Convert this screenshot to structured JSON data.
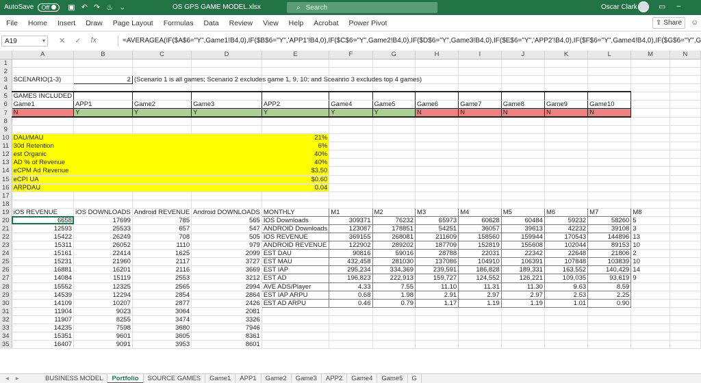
{
  "titlebar": {
    "autosave_label": "AutoSave",
    "autosave_state": "Off",
    "file_name": "OS GPS GAME MODEL.xlsx",
    "search_placeholder": "Search",
    "user_name": "Oscar Clark"
  },
  "ribbon": {
    "tabs": [
      "File",
      "Home",
      "Insert",
      "Draw",
      "Page Layout",
      "Formulas",
      "Data",
      "Review",
      "View",
      "Help",
      "Acrobat",
      "Power Pivot"
    ],
    "share_label": "Share"
  },
  "formula_bar": {
    "name_box": "A19",
    "formula": "=AVERAGEA(IF($A$6=\"Y\",Game1!B4,0),IF($B$6=\"Y\",'APP1'!B4,0),IF($C$6=\"Y\",Game2!B4,0),IF($D$6=\"Y\",Game3!B4,0),IF($E$6=\"Y\",'APP2'!B4,0),IF($F$6=\"Y\",Game4!B4,0),IF($G$6=\"Y\",Game5!B4,0),IF($H$6=\"Y\",Game6!B4,0)"
  },
  "columns": [
    "A",
    "B",
    "C",
    "D",
    "E",
    "F",
    "G",
    "H",
    "I",
    "J",
    "K",
    "L",
    "M",
    "N"
  ],
  "rows": [
    [],
    [],
    [
      "SCENARIO(1-3)",
      "2",
      "(Scenario 1 is all games; Scenario 2 excludes game 1, 9, 10; and Sceanrio 3 excludes top 4 games)"
    ],
    [],
    [
      "GAMES INCLUDED"
    ],
    [
      "Game1",
      "APP1",
      "Game2",
      "Game3",
      "APP2",
      "Game4",
      "Game5",
      "Game6",
      "Game7",
      "Game8",
      "Game9",
      "Game10"
    ],
    [
      "N",
      "Y",
      "Y",
      "Y",
      "Y",
      "Y",
      "Y",
      "N",
      "N",
      "N",
      "N",
      "N"
    ],
    [],
    [],
    [
      "DAU/MAU",
      "21%"
    ],
    [
      "30d Retention",
      "6%"
    ],
    [
      "est Organic",
      "40%"
    ],
    [
      "AD % of Revenue",
      "40%"
    ],
    [
      "eCPM Ad Revenue",
      "$3.50"
    ],
    [
      "eCPI UA",
      "$0.60"
    ],
    [
      "ARPDAU",
      "0.04"
    ],
    [],
    [],
    [
      "iOS REVENUE",
      "iOS DOWNLOADS",
      "Android REVENUE",
      "Android DOWNLOADS",
      "MONTHLY",
      "M1",
      "M2",
      "M3",
      "M4",
      "M5",
      "M6",
      "M7",
      "M8"
    ],
    [
      "6658",
      "17699",
      "785",
      "565",
      "IOS Downloads",
      "309371",
      "76232",
      "65973",
      "60628",
      "60484",
      "59232",
      "58260",
      "5"
    ],
    [
      "12593",
      "25533",
      "657",
      "547",
      "ANDROID Downloads",
      "123087",
      "178851",
      "54251",
      "36057",
      "39613",
      "42232",
      "39108",
      "3"
    ],
    [
      "15422",
      "26249",
      "708",
      "505",
      "IOS REVENUE",
      "369155",
      "268081",
      "211609",
      "158560",
      "159944",
      "170543",
      "144896",
      "13"
    ],
    [
      "15311",
      "26052",
      "1110",
      "979",
      "ANDROID REVENUE",
      "122902",
      "289202",
      "187709",
      "152819",
      "155608",
      "102044",
      "89153",
      "10"
    ],
    [
      "15161",
      "22414",
      "1625",
      "2099",
      "EST DAU",
      "90816",
      "59016",
      "28788",
      "22031",
      "22342",
      "22648",
      "21806",
      "2"
    ],
    [
      "15231",
      "21960",
      "2117",
      "3727",
      "EST MAU",
      "432,458",
      "281030",
      "137086",
      "104910",
      "106391",
      "107848",
      "103839",
      "10"
    ],
    [
      "16881",
      "16201",
      "2116",
      "3669",
      "EST IAP",
      "295,234",
      "334,369",
      "239,591",
      "186,828",
      "189,331",
      "163,552",
      "140,429",
      "14"
    ],
    [
      "14084",
      "15119",
      "2553",
      "3212",
      "EST AD",
      "196,823",
      "222,913",
      "159,727",
      "124,552",
      "126,221",
      "109,035",
      "93,619",
      "9"
    ],
    [
      "15552",
      "12325",
      "2565",
      "2994",
      "AVE ADS/Player",
      "4.33",
      "7.55",
      "11.10",
      "11.31",
      "11.30",
      "9.63",
      "8.59",
      ""
    ],
    [
      "14539",
      "12294",
      "2854",
      "2864",
      "EST IAP ARPU",
      "0.68",
      "1.98",
      "2.91",
      "2.97",
      "2.97",
      "2.53",
      "2.25",
      ""
    ],
    [
      "14109",
      "10207",
      "2877",
      "2426",
      "EST AD ARPU",
      "0.46",
      "0.79",
      "1.17",
      "1.19",
      "1.19",
      "1.01",
      "0.90",
      ""
    ],
    [
      "11904",
      "9023",
      "3064",
      "2081"
    ],
    [
      "11907",
      "8255",
      "3474",
      "3326"
    ],
    [
      "14235",
      "7598",
      "3680",
      "7946"
    ],
    [
      "15351",
      "9601",
      "3605",
      "8361"
    ],
    [
      "16407",
      "9091",
      "3953",
      "8601"
    ]
  ],
  "sheet_tabs": [
    "BUSINESS MODEL",
    "Portfolio",
    "SOURCE GAMES",
    "Game1",
    "APP1",
    "Game2",
    "Game3",
    "APP2",
    "Game4",
    "Game5",
    "G"
  ],
  "active_sheet": "Portfolio",
  "colors": {
    "excel_green": "#217346",
    "highlight_yellow": "#ffff00",
    "included_green": "#a9d08e",
    "excluded_red": "#f08080"
  }
}
